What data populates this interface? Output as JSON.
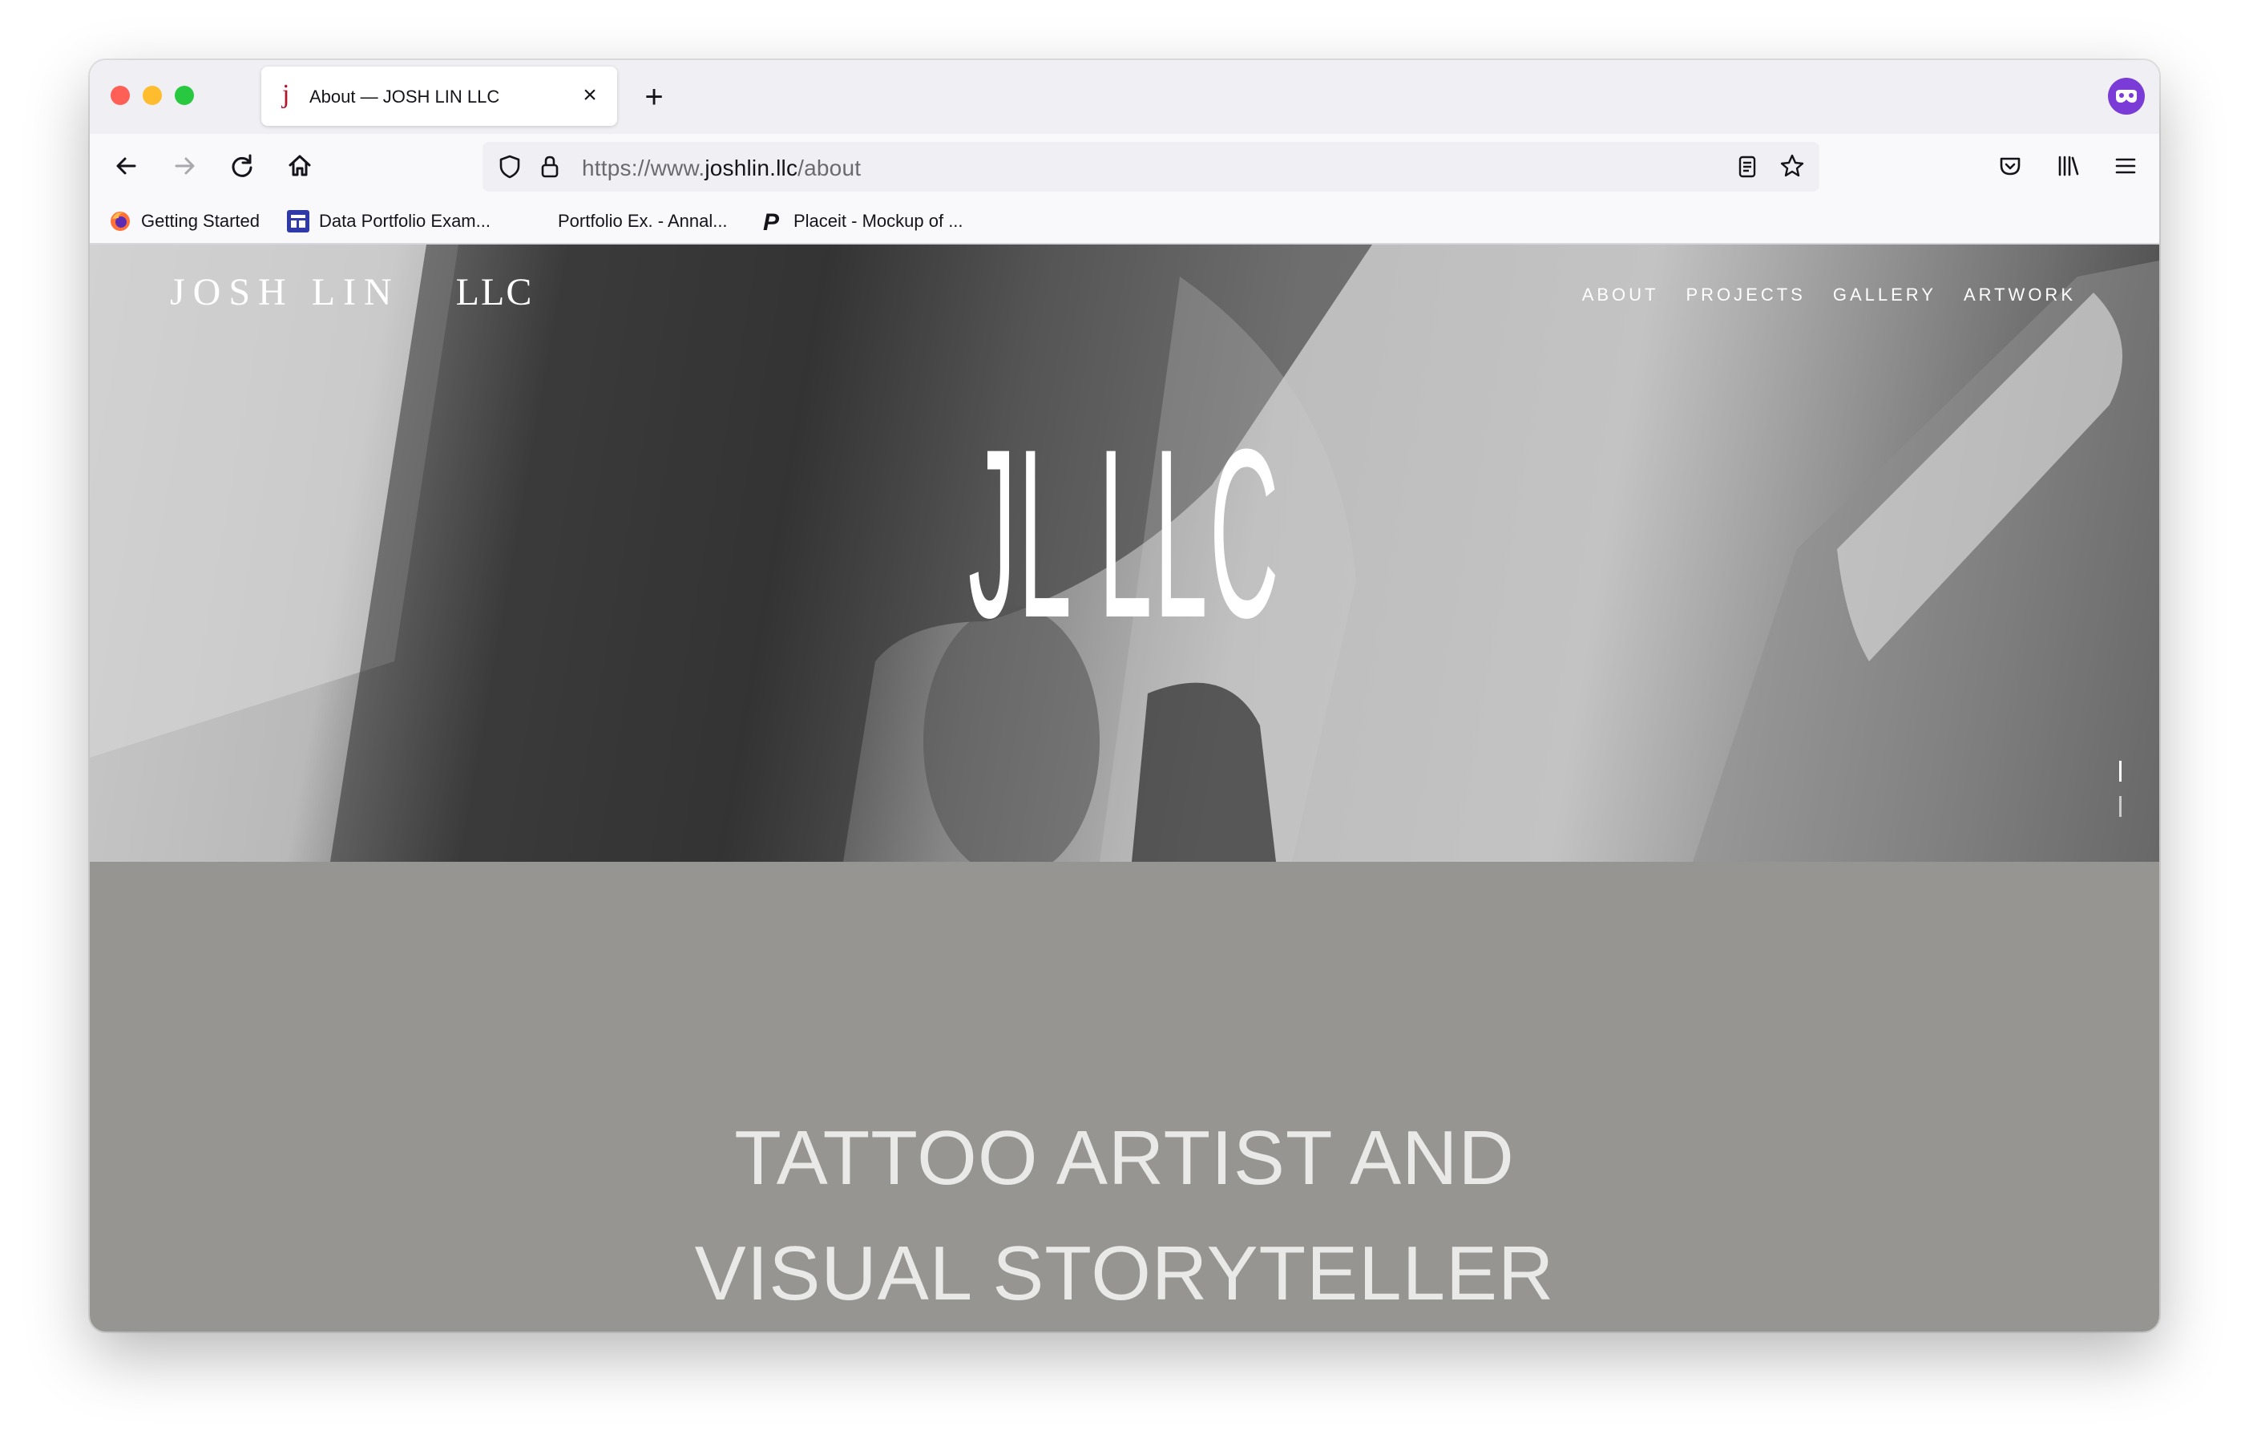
{
  "browser": {
    "tab": {
      "favicon": "j",
      "title": "About — JOSH LIN LLC",
      "close_glyph": "×"
    },
    "new_tab_glyph": "+",
    "toolbar": {
      "back_icon": "back-arrow-icon",
      "forward_icon": "forward-arrow-icon",
      "reload_icon": "reload-icon",
      "home_icon": "home-icon"
    },
    "url": {
      "scheme": "https://www.",
      "domain": "joshlin.llc",
      "path": "/about"
    },
    "bookmarks": [
      {
        "label": "Getting Started",
        "icon": "firefox-icon"
      },
      {
        "label": "Data Portfolio Exam...",
        "icon": "layout-icon"
      },
      {
        "label": "Portfolio Ex. - Annal...",
        "icon": ""
      },
      {
        "label": "Placeit - Mockup of ...",
        "icon": "placeit-icon"
      }
    ],
    "extension_icon": "mask-icon"
  },
  "site": {
    "brand": "JOSH LIN",
    "brand_suffix": "LLC",
    "nav": [
      "ABOUT",
      "PROJECTS",
      "GALLERY",
      "ARTWORK"
    ],
    "hero_monogram": "JL LLC",
    "tagline_line1": "TATTOO ARTIST AND",
    "tagline_line2": "VISUAL STORYTELLER"
  },
  "colors": {
    "page_background": "#979591",
    "tagline_text": "#e9e9e7",
    "extension_badge": "#7a3bd6"
  }
}
